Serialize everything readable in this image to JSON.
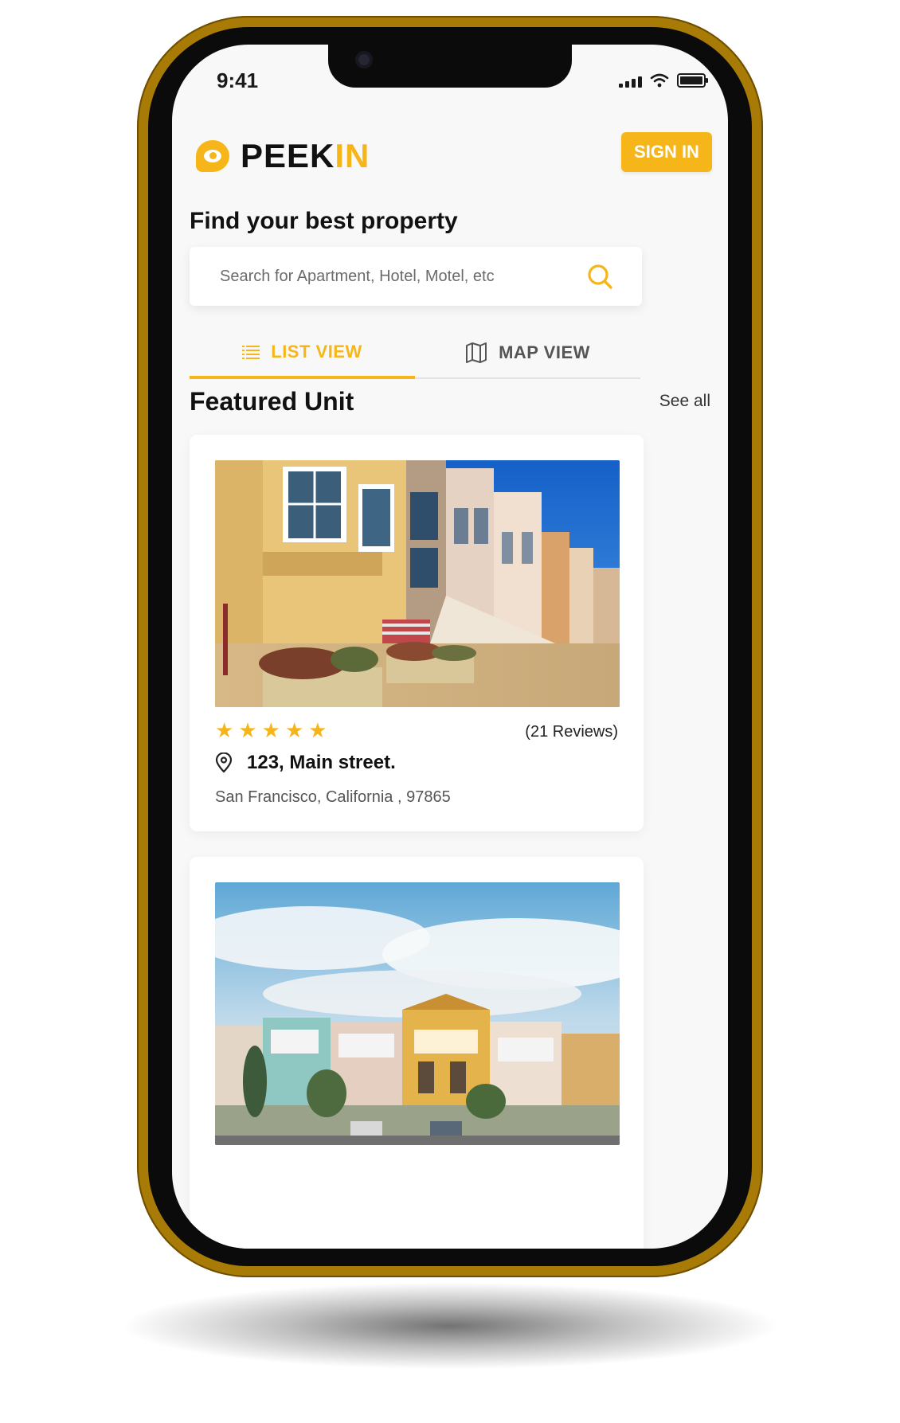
{
  "status": {
    "time": "9:41"
  },
  "brand": {
    "name_main": "PEEK",
    "name_accent": "IN",
    "signin_label": "SIGN IN"
  },
  "search": {
    "title": "Find your best property",
    "placeholder": "Search for Apartment, Hotel, Motel, etc"
  },
  "tabs": [
    {
      "label": "LIST VIEW",
      "active": true
    },
    {
      "label": "MAP VIEW",
      "active": false
    }
  ],
  "featured": {
    "title": "Featured Unit",
    "see_all": "See all"
  },
  "listings": [
    {
      "rating": 5,
      "reviews": "(21 Reviews)",
      "street": "123,  Main street.",
      "city": "San Francisco, California , 97865"
    },
    {}
  ],
  "colors": {
    "accent": "#f6b61a",
    "frame": "#a87a06",
    "text": "#111111"
  }
}
